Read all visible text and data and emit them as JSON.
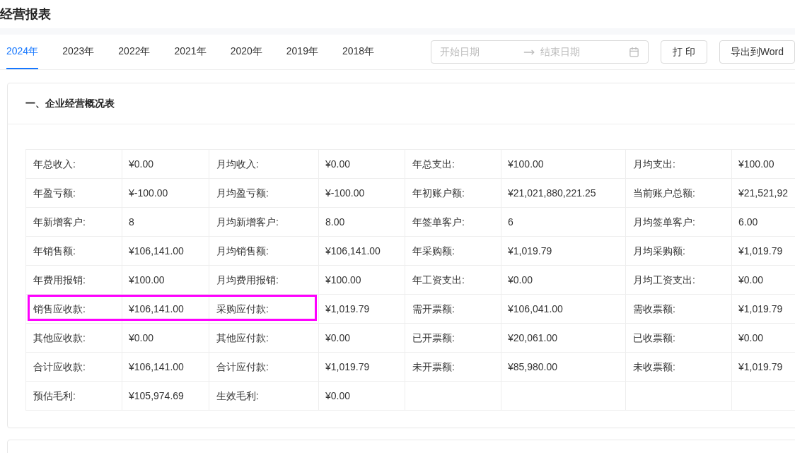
{
  "page_title": "经营报表",
  "tabs": [
    {
      "label": "2024年",
      "selected": true
    },
    {
      "label": "2023年",
      "selected": false
    },
    {
      "label": "2022年",
      "selected": false
    },
    {
      "label": "2021年",
      "selected": false
    },
    {
      "label": "2020年",
      "selected": false
    },
    {
      "label": "2019年",
      "selected": false
    },
    {
      "label": "2018年",
      "selected": false
    }
  ],
  "date_range": {
    "start_placeholder": "开始日期",
    "end_placeholder": "结束日期"
  },
  "buttons": [
    "打 印",
    "导出到Word"
  ],
  "section": {
    "title": "一、企业经营概况表",
    "rows": [
      [
        {
          "label": "年总收入:",
          "value": "¥0.00"
        },
        {
          "label": "月均收入:",
          "value": "¥0.00"
        },
        {
          "label": "年总支出:",
          "value": "¥100.00"
        },
        {
          "label": "月均支出:",
          "value": "¥100.00"
        }
      ],
      [
        {
          "label": "年盈亏额:",
          "value": "¥-100.00"
        },
        {
          "label": "月均盈亏额:",
          "value": "¥-100.00"
        },
        {
          "label": "年初账户额:",
          "value": "¥21,021,880,221.25"
        },
        {
          "label": "当前账户总额:",
          "value": "¥21,521,92"
        }
      ],
      [
        {
          "label": "年新增客户:",
          "value": "8"
        },
        {
          "label": "月均新增客户:",
          "value": "8.00"
        },
        {
          "label": "年签单客户:",
          "value": "6"
        },
        {
          "label": "月均签单客户:",
          "value": "6.00"
        }
      ],
      [
        {
          "label": "年销售额:",
          "value": "¥106,141.00"
        },
        {
          "label": "月均销售额:",
          "value": "¥106,141.00"
        },
        {
          "label": "年采购额:",
          "value": "¥1,019.79"
        },
        {
          "label": "月均采购额:",
          "value": "¥1,019.79"
        }
      ],
      [
        {
          "label": "年费用报销:",
          "value": "¥100.00"
        },
        {
          "label": "月均费用报销:",
          "value": "¥100.00"
        },
        {
          "label": "年工资支出:",
          "value": "¥0.00"
        },
        {
          "label": "月均工资支出:",
          "value": "¥0.00"
        }
      ],
      [
        {
          "label": "销售应收款:",
          "value": "¥106,141.00"
        },
        {
          "label": "采购应付款:",
          "value": "¥1,019.79"
        },
        {
          "label": "需开票额:",
          "value": "¥106,041.00"
        },
        {
          "label": "需收票额:",
          "value": "¥1,019.79"
        }
      ],
      [
        {
          "label": "其他应收款:",
          "value": "¥0.00"
        },
        {
          "label": "其他应付款:",
          "value": "¥0.00"
        },
        {
          "label": "已开票额:",
          "value": "¥20,061.00"
        },
        {
          "label": "已收票额:",
          "value": "¥0.00"
        }
      ],
      [
        {
          "label": "合计应收款:",
          "value": "¥106,141.00"
        },
        {
          "label": "合计应付款:",
          "value": "¥1,019.79"
        },
        {
          "label": "未开票额:",
          "value": "¥85,980.00"
        },
        {
          "label": "未收票额:",
          "value": "¥1,019.79"
        }
      ],
      [
        {
          "label": "预估毛利:",
          "value": "¥105,974.69"
        },
        {
          "label": "生效毛利:",
          "value": "¥0.00"
        }
      ]
    ]
  }
}
